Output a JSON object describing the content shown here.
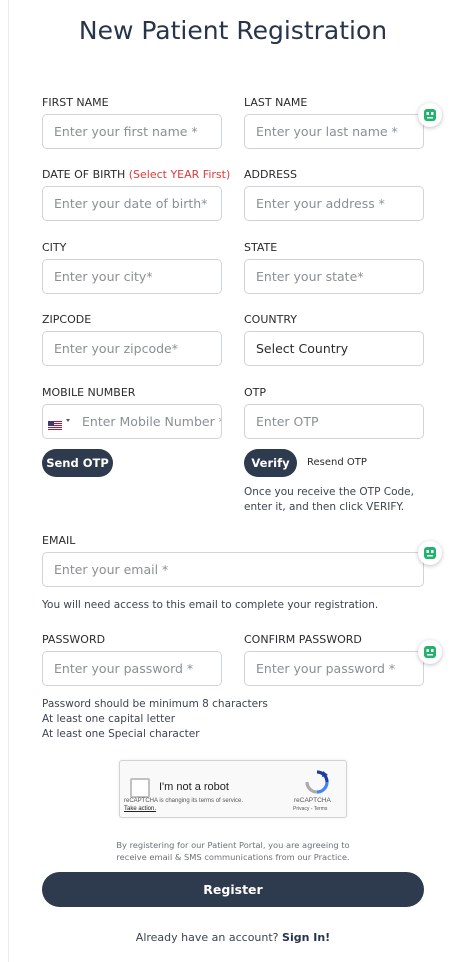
{
  "title": "New Patient Registration",
  "form": {
    "first_name": {
      "label": "FIRST NAME",
      "placeholder": "Enter your first name *"
    },
    "last_name": {
      "label": "LAST NAME",
      "placeholder": "Enter your last name *"
    },
    "dob": {
      "label": "DATE OF BIRTH",
      "hint": "(Select YEAR First)",
      "placeholder": "Enter your date of birth*"
    },
    "address": {
      "label": "ADDRESS",
      "placeholder": "Enter your address *"
    },
    "city": {
      "label": "CITY",
      "placeholder": "Enter your city*"
    },
    "state": {
      "label": "STATE",
      "placeholder": "Enter your state*"
    },
    "zipcode": {
      "label": "ZIPCODE",
      "placeholder": "Enter your zipcode*"
    },
    "country": {
      "label": "COUNTRY",
      "value": "Select Country"
    },
    "mobile": {
      "label": "MOBILE NUMBER",
      "placeholder": "Enter Mobile Number *"
    },
    "otp": {
      "label": "OTP",
      "placeholder": "Enter OTP"
    },
    "send_otp": "Send OTP",
    "verify": "Verify",
    "resend_otp": "Resend OTP",
    "otp_help_1": "Once you receive the OTP Code,",
    "otp_help_2": "enter it, and then click VERIFY.",
    "email": {
      "label": "EMAIL",
      "placeholder": "Enter your email *"
    },
    "email_help": "You will need access to this email to complete your registration.",
    "password": {
      "label": "PASSWORD",
      "placeholder": "Enter your password *"
    },
    "confirm_password": {
      "label": "CONFIRM PASSWORD",
      "placeholder": "Enter your password *"
    },
    "password_rules": [
      "Password should be minimum 8 characters",
      "At least one capital letter",
      "At least one Special character"
    ]
  },
  "recaptcha": {
    "label": "I'm not a robot",
    "notice": "reCAPTCHA is changing its terms of service.",
    "take_action": "Take action.",
    "brand": "reCAPTCHA",
    "privacy": "Privacy",
    "terms": "Terms"
  },
  "consent_line_1": "By registering for our Patient Portal, you are agreeing to",
  "consent_line_2": "receive email & SMS communications from our Practice.",
  "register_label": "Register",
  "signin_prompt": "Already have an account?",
  "signin_link": "Sign In!",
  "colors": {
    "primary": "#2e3a4d",
    "hint_red": "#e03a3a",
    "bot_green": "#1fb36b"
  }
}
